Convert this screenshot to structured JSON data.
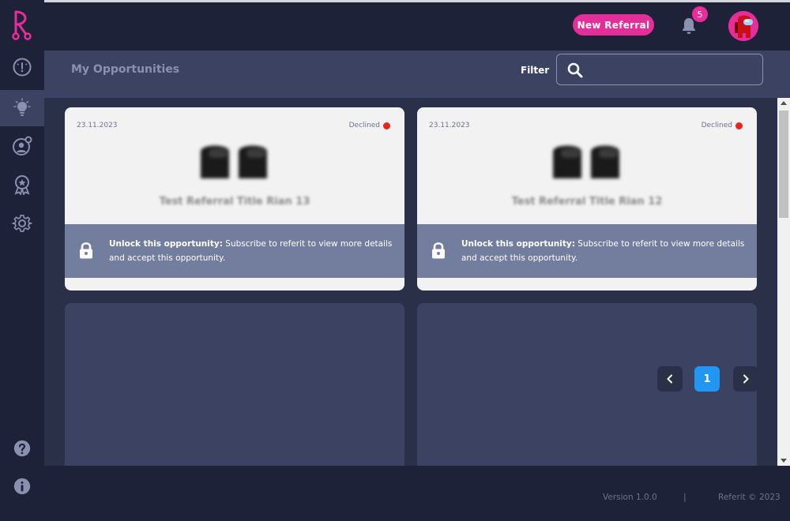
{
  "header": {
    "new_referral_label": "New Referral",
    "notification_count": "5"
  },
  "sidebar": {
    "items": [
      {
        "name": "dashboard",
        "icon": "gauge-icon",
        "active": false
      },
      {
        "name": "opportunities",
        "icon": "lightbulb-icon",
        "active": true
      },
      {
        "name": "referrals",
        "icon": "user-target-icon",
        "active": false
      },
      {
        "name": "rewards",
        "icon": "award-badge-icon",
        "active": false
      },
      {
        "name": "settings",
        "icon": "gear-icon",
        "active": false
      }
    ],
    "bottom_items": [
      {
        "name": "help",
        "icon": "help-circle-icon"
      },
      {
        "name": "info",
        "icon": "info-circle-icon"
      }
    ]
  },
  "titlebar": {
    "title": "My Opportunities",
    "filter_label": "Filter",
    "search_value": ""
  },
  "cards": [
    {
      "date": "23.11.2023",
      "status": "Declined",
      "title": "Test Referral Title Rian 13",
      "unlock_bold": "Unlock this opportunity:",
      "unlock_text": " Subscribe to referit to view more details and accept this opportunity."
    },
    {
      "date": "23.11.2023",
      "status": "Declined",
      "title": "Test Referral Title Rian 12",
      "unlock_bold": "Unlock this opportunity:",
      "unlock_text": " Subscribe to referit to view more details and accept this opportunity."
    }
  ],
  "pagination": {
    "current_page": "1"
  },
  "footer": {
    "version": "Version 1.0.0",
    "separator": "|",
    "copyright": "Referit © 2023"
  },
  "colors": {
    "brand_pink": "#e62e9a",
    "status_declined": "#e8241c",
    "page_active": "#2196f3"
  }
}
